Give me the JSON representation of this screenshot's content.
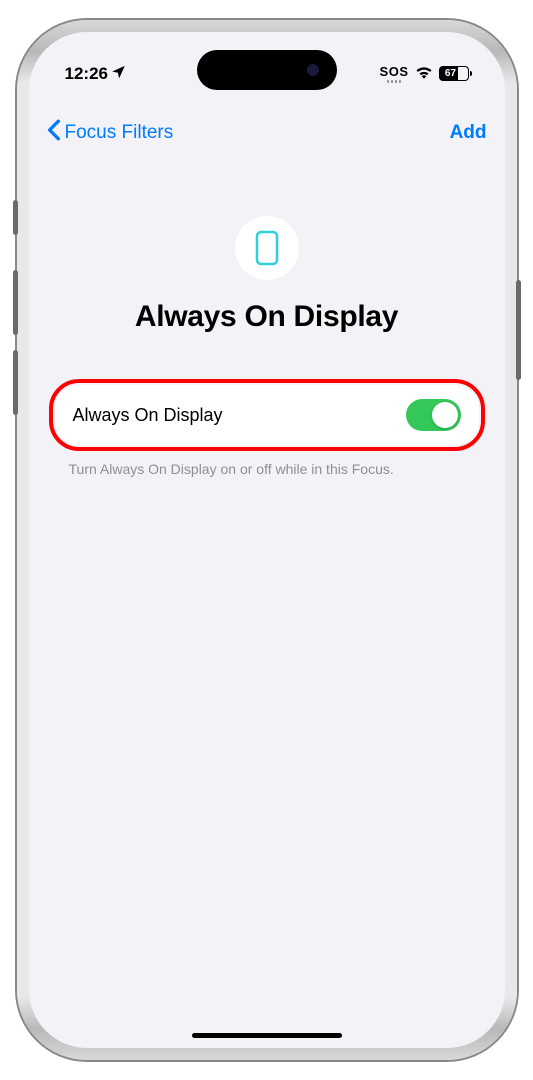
{
  "status": {
    "time": "12:26",
    "sos": "SOS",
    "battery": "67"
  },
  "nav": {
    "back": "Focus Filters",
    "add": "Add"
  },
  "hero": {
    "title": "Always On Display"
  },
  "setting": {
    "label": "Always On Display",
    "enabled": true
  },
  "footer": {
    "text": "Turn Always On Display on or off while in this Focus."
  }
}
